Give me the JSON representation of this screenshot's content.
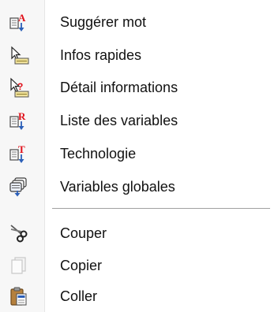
{
  "menu": {
    "items": [
      {
        "label": "Suggérer mot",
        "icon": "suggest-word-icon"
      },
      {
        "label": "Infos rapides",
        "icon": "quick-info-icon"
      },
      {
        "label": "Détail informations",
        "icon": "detailed-info-icon"
      },
      {
        "label": "Liste des variables",
        "icon": "variables-list-icon"
      },
      {
        "label": "Technologie",
        "icon": "technology-icon"
      },
      {
        "label": "Variables globales",
        "icon": "global-variables-icon"
      },
      {
        "label": "Couper",
        "icon": "scissors-icon"
      },
      {
        "label": "Copier",
        "icon": "copy-icon"
      },
      {
        "label": "Coller",
        "icon": "paste-icon"
      }
    ]
  },
  "colors": {
    "red_accent": "#e0101a",
    "blue_accent": "#2b5fb8",
    "text": "#111111",
    "separator": "#a0a0a0"
  }
}
